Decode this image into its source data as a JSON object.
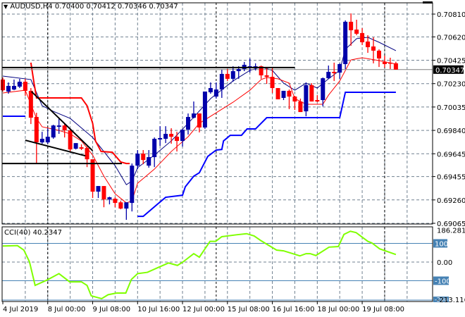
{
  "header": {
    "arrow": "▼",
    "symbol": "AUDUSD,H4",
    "ohlc": "0.70400 0.70412 0.70346 0.70347"
  },
  "colors": {
    "bull": "#0000aa",
    "bear": "#ff0000",
    "ma_fast": "#000080",
    "ma_slow": "#ff0000",
    "band_upper": "#ff0000",
    "band_lower": "#0000ff",
    "cci": "#7fff00",
    "level": "#4682b4",
    "grid": "#708090"
  },
  "chart_data": [
    {
      "type": "candlestick",
      "title": "AUDUSD,H4",
      "ylim": [
        0.69065,
        0.7081
      ],
      "y_ticks": [
        "0.70810",
        "0.70620",
        "0.70425",
        "0.70230",
        "0.70035",
        "0.69840",
        "0.69645",
        "0.69455",
        "0.69260",
        "0.69065"
      ],
      "current_price": "0.70347",
      "x_labels": [
        {
          "idx": 0,
          "text": "4 Jul 2019"
        },
        {
          "idx": 8,
          "text": "8 Jul 00:00"
        },
        {
          "idx": 16,
          "text": "9 Jul 08:00"
        },
        {
          "idx": 24,
          "text": "10 Jul 16:00"
        },
        {
          "idx": 32,
          "text": "12 Jul 00:00"
        },
        {
          "idx": 40,
          "text": "15 Jul 08:00"
        },
        {
          "idx": 48,
          "text": "16 Jul 16:00"
        },
        {
          "idx": 56,
          "text": "18 Jul 00:00"
        },
        {
          "idx": 64,
          "text": "19 Jul 08:00"
        }
      ],
      "separators": [
        8,
        38,
        68
      ],
      "candles_ohlc": [
        [
          0.70264,
          0.70281,
          0.70164,
          0.70175
        ],
        [
          0.70164,
          0.7024,
          0.70146,
          0.70211
        ],
        [
          0.70181,
          0.70264,
          0.70175,
          0.70211
        ],
        [
          0.70205,
          0.7027,
          0.70193,
          0.70246
        ],
        [
          0.70246,
          0.7027,
          0.70128,
          0.7017
        ],
        [
          0.7017,
          0.70193,
          0.69893,
          0.69946
        ],
        [
          0.69952,
          0.69987,
          0.69564,
          0.6974
        ],
        [
          0.6974,
          0.69828,
          0.69729,
          0.6977
        ],
        [
          0.6974,
          0.69858,
          0.69729,
          0.69787
        ],
        [
          0.69781,
          0.69887,
          0.6977,
          0.69881
        ],
        [
          0.6987,
          0.6994,
          0.69811,
          0.69881
        ],
        [
          0.69881,
          0.69899,
          0.69781,
          0.6984
        ],
        [
          0.6984,
          0.69858,
          0.69664,
          0.69681
        ],
        [
          0.69687,
          0.69734,
          0.69681,
          0.69734
        ],
        [
          0.69699,
          0.69723,
          0.69676,
          0.69687
        ],
        [
          0.69693,
          0.69705,
          0.69534,
          0.69599
        ],
        [
          0.69599,
          0.69599,
          0.69276,
          0.69329
        ],
        [
          0.69329,
          0.69376,
          0.69276,
          0.69376
        ],
        [
          0.69376,
          0.69376,
          0.69199,
          0.69264
        ],
        [
          0.69264,
          0.69287,
          0.69223,
          0.69282
        ],
        [
          0.6927,
          0.69282,
          0.69199,
          0.69235
        ],
        [
          0.6924,
          0.69252,
          0.69182,
          0.69188
        ],
        [
          0.69188,
          0.6924,
          0.69094,
          0.6924
        ],
        [
          0.69235,
          0.69564,
          0.69164,
          0.69546
        ],
        [
          0.69546,
          0.69676,
          0.69517,
          0.69646
        ],
        [
          0.69646,
          0.69676,
          0.69558,
          0.69593
        ],
        [
          0.69546,
          0.69676,
          0.69529,
          0.69617
        ],
        [
          0.69617,
          0.69781,
          0.69534,
          0.6977
        ],
        [
          0.69764,
          0.69875,
          0.69711,
          0.69776
        ],
        [
          0.6977,
          0.69875,
          0.69734,
          0.69811
        ],
        [
          0.69811,
          0.69858,
          0.69729,
          0.69787
        ],
        [
          0.69787,
          0.69828,
          0.69664,
          0.69752
        ],
        [
          0.69752,
          0.69846,
          0.69705,
          0.69846
        ],
        [
          0.69846,
          0.69981,
          0.69805,
          0.69952
        ],
        [
          0.69946,
          0.70081,
          0.6994,
          0.69981
        ],
        [
          0.69981,
          0.69981,
          0.69823,
          0.69864
        ],
        [
          0.69864,
          0.70164,
          0.69852,
          0.70164
        ],
        [
          0.70158,
          0.7024,
          0.70146,
          0.70193
        ],
        [
          0.70122,
          0.7024,
          0.70105,
          0.70181
        ],
        [
          0.70181,
          0.70346,
          0.70111,
          0.70311
        ],
        [
          0.70311,
          0.70352,
          0.70252,
          0.7027
        ],
        [
          0.7027,
          0.70375,
          0.70246,
          0.70334
        ],
        [
          0.70334,
          0.70375,
          0.7027,
          0.70352
        ],
        [
          0.70352,
          0.70411,
          0.70334,
          0.70387
        ],
        [
          0.70369,
          0.7044,
          0.70322,
          0.70375
        ],
        [
          0.70364,
          0.70399,
          0.7034,
          0.70375
        ],
        [
          0.70375,
          0.70381,
          0.7027,
          0.70299
        ],
        [
          0.70299,
          0.70364,
          0.70228,
          0.70287
        ],
        [
          0.70287,
          0.70369,
          0.70152,
          0.70193
        ],
        [
          0.70193,
          0.70193,
          0.70099,
          0.70099
        ],
        [
          0.70111,
          0.7017,
          0.70093,
          0.7017
        ],
        [
          0.7017,
          0.70181,
          0.70017,
          0.70122
        ],
        [
          0.70122,
          0.70128,
          0.70011,
          0.70081
        ],
        [
          0.70081,
          0.70105,
          0.69993,
          0.69993
        ],
        [
          0.69999,
          0.7024,
          0.69958,
          0.70217
        ],
        [
          0.70217,
          0.70234,
          0.70081,
          0.70081
        ],
        [
          0.70093,
          0.70134,
          0.70075,
          0.70081
        ],
        [
          0.70093,
          0.70281,
          0.7004,
          0.70275
        ],
        [
          0.70275,
          0.70381,
          0.7027,
          0.70328
        ],
        [
          0.70328,
          0.70405,
          0.70252,
          0.70317
        ],
        [
          0.70322,
          0.70399,
          0.7027,
          0.70393
        ],
        [
          0.70393,
          0.70757,
          0.70352,
          0.70746
        ],
        [
          0.70746,
          0.70816,
          0.70546,
          0.70675
        ],
        [
          0.70681,
          0.70763,
          0.70634,
          0.70646
        ],
        [
          0.70652,
          0.70693,
          0.70552,
          0.70575
        ],
        [
          0.70581,
          0.70634,
          0.70487,
          0.70534
        ],
        [
          0.7054,
          0.70616,
          0.70399,
          0.70505
        ],
        [
          0.70505,
          0.70516,
          0.70369,
          0.7044
        ],
        [
          0.70411,
          0.70463,
          0.70364,
          0.70393
        ],
        [
          0.70405,
          0.70446,
          0.70352,
          0.70399
        ],
        [
          0.704,
          0.70412,
          0.70346,
          0.70347
        ]
      ],
      "lines": [
        {
          "name": "ma-fast",
          "color_key": "ma_fast",
          "width": 1,
          "points": [
            [
              0,
              0.70293
            ],
            [
              5,
              0.70264
            ],
            [
              7,
              0.70046
            ],
            [
              9,
              0.69999
            ],
            [
              12,
              0.6994
            ],
            [
              16,
              0.69781
            ],
            [
              20,
              0.69546
            ],
            [
              22,
              0.69387
            ],
            [
              23,
              0.69417
            ],
            [
              24,
              0.69529
            ],
            [
              27,
              0.69634
            ],
            [
              30,
              0.69752
            ],
            [
              33,
              0.69899
            ],
            [
              37,
              0.70105
            ],
            [
              41,
              0.70252
            ],
            [
              44,
              0.7034
            ],
            [
              46,
              0.70369
            ],
            [
              48,
              0.7034
            ],
            [
              50,
              0.70234
            ],
            [
              52,
              0.70175
            ],
            [
              54,
              0.70234
            ],
            [
              56,
              0.70193
            ],
            [
              58,
              0.7027
            ],
            [
              60,
              0.7034
            ],
            [
              61,
              0.70516
            ],
            [
              63,
              0.70605
            ],
            [
              65,
              0.70616
            ],
            [
              67,
              0.70575
            ],
            [
              70,
              0.70505
            ]
          ]
        },
        {
          "name": "ma-slow",
          "color_key": "ma_slow",
          "width": 1,
          "points": [
            [
              0,
              0.70152
            ],
            [
              4,
              0.70175
            ],
            [
              6,
              0.6994
            ],
            [
              7,
              0.6987
            ],
            [
              10,
              0.6984
            ],
            [
              12,
              0.69811
            ],
            [
              14,
              0.69752
            ],
            [
              16,
              0.69634
            ],
            [
              18,
              0.69458
            ],
            [
              20,
              0.69311
            ],
            [
              22,
              0.69235
            ],
            [
              23,
              0.69252
            ],
            [
              24,
              0.69399
            ],
            [
              27,
              0.69517
            ],
            [
              30,
              0.69664
            ],
            [
              33,
              0.69787
            ],
            [
              35,
              0.69899
            ],
            [
              38,
              0.69987
            ],
            [
              41,
              0.70075
            ],
            [
              44,
              0.70175
            ],
            [
              46,
              0.70264
            ],
            [
              47,
              0.70281
            ],
            [
              49,
              0.7027
            ],
            [
              51,
              0.70234
            ],
            [
              52,
              0.70105
            ],
            [
              54,
              0.70058
            ],
            [
              57,
              0.70058
            ],
            [
              58,
              0.70134
            ],
            [
              60,
              0.70252
            ],
            [
              62,
              0.70428
            ],
            [
              64,
              0.70446
            ],
            [
              67,
              0.70422
            ],
            [
              70,
              0.70393
            ]
          ]
        },
        {
          "name": "upper-band",
          "color_key": "band_upper",
          "width": 2,
          "points": [
            [
              5,
              0.70405
            ],
            [
              5.5,
              0.70252
            ],
            [
              6,
              0.70111
            ],
            [
              14,
              0.70111
            ],
            [
              15,
              0.70046
            ],
            [
              16,
              0.69899
            ],
            [
              16.5,
              0.69752
            ],
            [
              17.5,
              0.69664
            ],
            [
              19.5,
              0.69658
            ],
            [
              21,
              0.69576
            ],
            [
              22,
              0.69564
            ],
            [
              22.6,
              0.69564
            ]
          ]
        },
        {
          "name": "lower-band-1",
          "color_key": "band_lower",
          "width": 2,
          "points": [
            [
              0,
              0.69958
            ],
            [
              4,
              0.69958
            ]
          ]
        },
        {
          "name": "lower-band-2",
          "color_key": "band_lower",
          "width": 2,
          "points": [
            [
              24,
              0.69123
            ],
            [
              25,
              0.69123
            ],
            [
              27.5,
              0.69223
            ],
            [
              29,
              0.69282
            ],
            [
              32,
              0.69299
            ],
            [
              32.5,
              0.6937
            ],
            [
              34,
              0.69458
            ],
            [
              35,
              0.69487
            ],
            [
              36.5,
              0.69623
            ],
            [
              38,
              0.69676
            ],
            [
              39,
              0.69681
            ],
            [
              39.3,
              0.69752
            ],
            [
              40.5,
              0.69799
            ],
            [
              42.5,
              0.69799
            ],
            [
              43.5,
              0.69852
            ],
            [
              45,
              0.69852
            ],
            [
              47,
              0.69946
            ],
            [
              60,
              0.69946
            ],
            [
              61,
              0.70158
            ],
            [
              70,
              0.70158
            ]
          ]
        }
      ],
      "drawings": [
        {
          "name": "resistance-line",
          "points": [
            [
              -0.1,
              0.70364
            ],
            [
              52,
              0.70364
            ]
          ]
        },
        {
          "name": "support-line",
          "points": [
            [
              -0.1,
              0.69564
            ],
            [
              21.2,
              0.69564
            ]
          ]
        },
        {
          "name": "upper-trendline",
          "points": [
            [
              5.1,
              0.70164
            ],
            [
              16,
              0.6967
            ]
          ]
        },
        {
          "name": "lower-trendline",
          "points": [
            [
              4,
              0.69758
            ],
            [
              14.7,
              0.69628
            ]
          ]
        }
      ]
    },
    {
      "type": "line",
      "title": "CCI(40) 40.2347",
      "ylim": [
        -213.1163,
        186.2814
      ],
      "y_ticks": [
        "186.2814",
        "0.00",
        "-213.1163"
      ],
      "levels": [
        "100",
        "-100"
      ],
      "level_values": [
        100,
        -100
      ],
      "level_hidden": "-200",
      "x": [
        0,
        2.6,
        3.75,
        4.75,
        5.75,
        7.9,
        10,
        11.9,
        14,
        15,
        15.75,
        17.6,
        18.75,
        20.25,
        21.9,
        22.9,
        24,
        25.75,
        27.6,
        29.5,
        31.1,
        32.1,
        34,
        35,
        36.9,
        37.9,
        39,
        41.6,
        43.4,
        44.75,
        46,
        48.75,
        50,
        52.9,
        54,
        54.75,
        55.75,
        58.1,
        59.75,
        60.75,
        61.9,
        62.9,
        65,
        65.75,
        67.1,
        70
      ],
      "values": [
        86,
        88,
        64,
        1,
        -125,
        -96,
        -62,
        -106,
        -106,
        -125,
        -181,
        -196,
        -175,
        -166,
        -166,
        -93,
        -62,
        -55,
        -30,
        -5,
        -18,
        1,
        45,
        26,
        111,
        111,
        136,
        146,
        152,
        140,
        114,
        64,
        60,
        33,
        45,
        45,
        35,
        80,
        83,
        148,
        165,
        158,
        111,
        102,
        71,
        40.2
      ]
    }
  ]
}
